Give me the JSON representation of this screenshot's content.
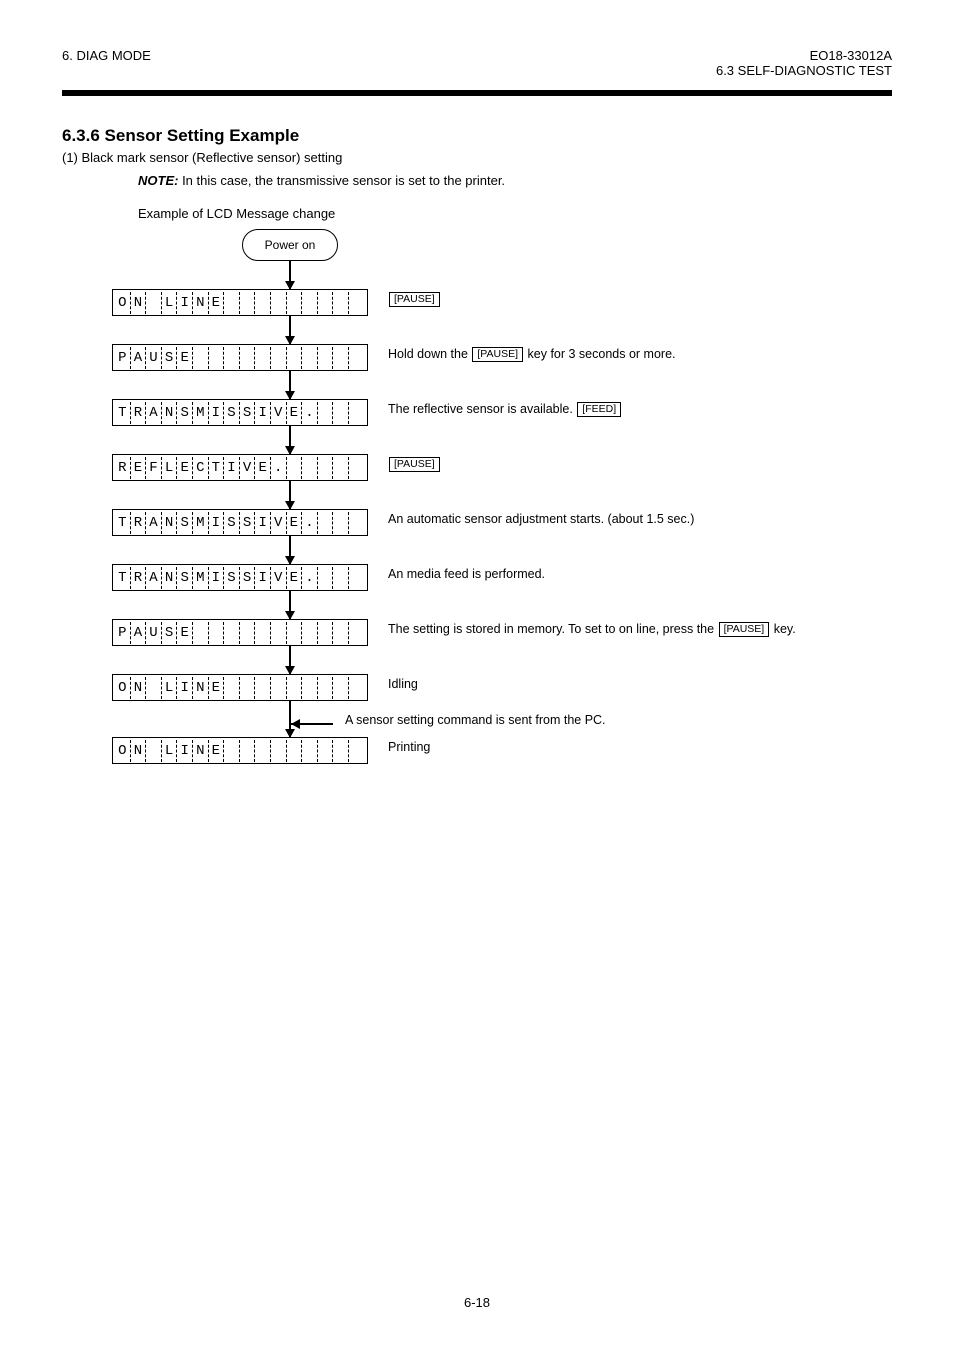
{
  "header": {
    "left": "6. DIAG MODE",
    "right_prefix": "EO18-33012A",
    "right_line2": "6.3 SELF-DIAGNOSTIC TEST"
  },
  "section": {
    "title": "6.3.6  Sensor Setting Example",
    "sub": "(1)  Black mark sensor (Reflective sensor) setting"
  },
  "note": {
    "label": "NOTE:",
    "body": "  In this case, the transmissive sensor is set to the printer."
  },
  "example_title": "Example of LCD Message change",
  "flow": {
    "start": "Power on",
    "rows": [
      {
        "lcd": "ON LINE",
        "label": "[PAUSE]",
        "key": true
      },
      {
        "lcd": "PAUSE",
        "label": "Hold down the [PAUSE] key for 3 seconds or more.",
        "key_inline": "PAUSE"
      },
      {
        "lcd": "TRANSMISSIVE.",
        "label": "The reflective sensor is available.  [FEED]",
        "key": true
      },
      {
        "lcd": "REFLECTIVE.",
        "label": "[PAUSE]",
        "key": true
      },
      {
        "lcd": "TRANSMISSIVE.",
        "label": "An automatic sensor adjustment starts. (about 1.5 sec.)"
      },
      {
        "lcd": "TRANSMISSIVE.",
        "label": "An media feed is performed."
      },
      {
        "lcd": "PAUSE",
        "label": "The setting is stored in memory.  To set to on line, press the [PAUSE] key.",
        "key_inline": "PAUSE"
      },
      {
        "lcd": "ON LINE",
        "label": "Idling"
      }
    ],
    "side_in": "A sensor setting command is sent from the PC.",
    "last": {
      "lcd": "ON LINE",
      "label": "Printing"
    }
  },
  "footer": "6-18"
}
